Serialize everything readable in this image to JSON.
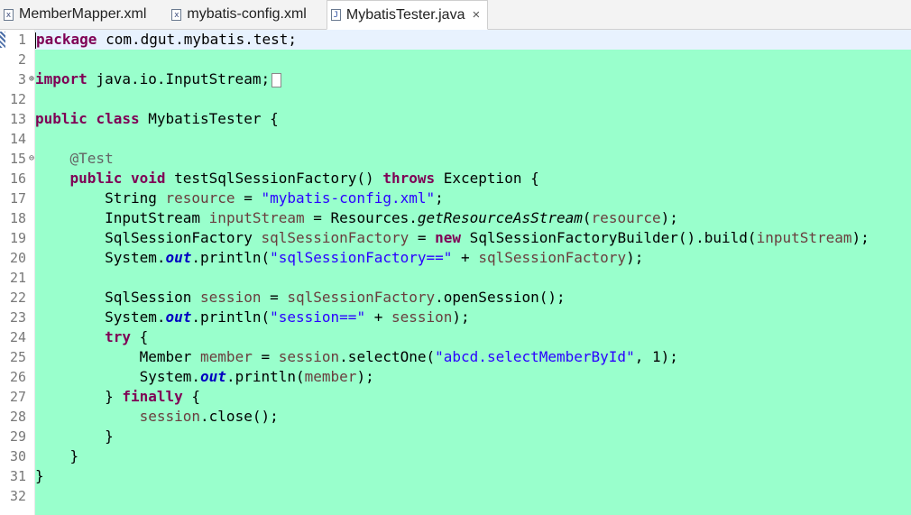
{
  "tabs": [
    {
      "label": "MemberMapper.xml",
      "icon": "xml-file-icon",
      "active": false
    },
    {
      "label": "mybatis-config.xml",
      "icon": "xml-file-icon",
      "active": false
    },
    {
      "label": "MybatisTester.java",
      "icon": "java-file-icon",
      "active": true
    }
  ],
  "tab_close_glyph": "×",
  "editor": {
    "background": "#99ffcc",
    "line_numbers": [
      "1",
      "2",
      "3",
      "12",
      "13",
      "14",
      "15",
      "16",
      "17",
      "18",
      "19",
      "20",
      "21",
      "22",
      "23",
      "24",
      "25",
      "26",
      "27",
      "28",
      "29",
      "30",
      "31",
      "32"
    ],
    "code": {
      "l1": {
        "kw": "package",
        "rest": " com.dgut.mybatis.test;"
      },
      "l3": {
        "kw": "import",
        "rest": " java.io.InputStream;"
      },
      "l13": {
        "kw1": "public",
        "kw2": "class",
        "rest": " MybatisTester {"
      },
      "l15": {
        "ann": "@Test"
      },
      "l16": {
        "kw1": "public",
        "kw2": "void",
        "mid": " testSqlSessionFactory() ",
        "kw3": "throws",
        "rest": " Exception {"
      },
      "l17": {
        "type": "String",
        "var": "resource",
        "eq": " = ",
        "str": "\"mybatis-config.xml\"",
        "end": ";"
      },
      "l18": {
        "type": "InputStream",
        "var": "inputStream",
        "eq": " = Resources.",
        "meth": "getResourceAsStream",
        "open": "(",
        "arg": "resource",
        "end": ");"
      },
      "l19": {
        "type": "SqlSessionFactory",
        "var": "sqlSessionFactory",
        "eq": " = ",
        "kw": "new",
        "mid": " SqlSessionFactoryBuilder().build(",
        "arg": "inputStream",
        "end": ");"
      },
      "l20": {
        "pre": "System.",
        "stat": "out",
        "mid": ".println(",
        "str": "\"sqlSessionFactory==\"",
        "plus": " + ",
        "arg": "sqlSessionFactory",
        "end": ");"
      },
      "l22": {
        "type": "SqlSession",
        "var": "session",
        "eq": " = ",
        "arg": "sqlSessionFactory",
        "end": ".openSession();"
      },
      "l23": {
        "pre": "System.",
        "stat": "out",
        "mid": ".println(",
        "str": "\"session==\"",
        "plus": " + ",
        "arg": "session",
        "end": ");"
      },
      "l24": {
        "kw": "try",
        "rest": " {"
      },
      "l25": {
        "type": "Member",
        "var": "member",
        "eq": " = ",
        "arg": "session",
        "mid": ".selectOne(",
        "str": "\"abcd.selectMemberById\"",
        "end": ", 1);"
      },
      "l26": {
        "pre": "System.",
        "stat": "out",
        "mid": ".println(",
        "arg": "member",
        "end": ");"
      },
      "l27": {
        "pre": "} ",
        "kw": "finally",
        "rest": " {"
      },
      "l28": {
        "arg": "session",
        "end": ".close();"
      },
      "l29": {
        "text": "}"
      },
      "l30": {
        "text": "}"
      },
      "l31": {
        "text": "}"
      }
    }
  }
}
